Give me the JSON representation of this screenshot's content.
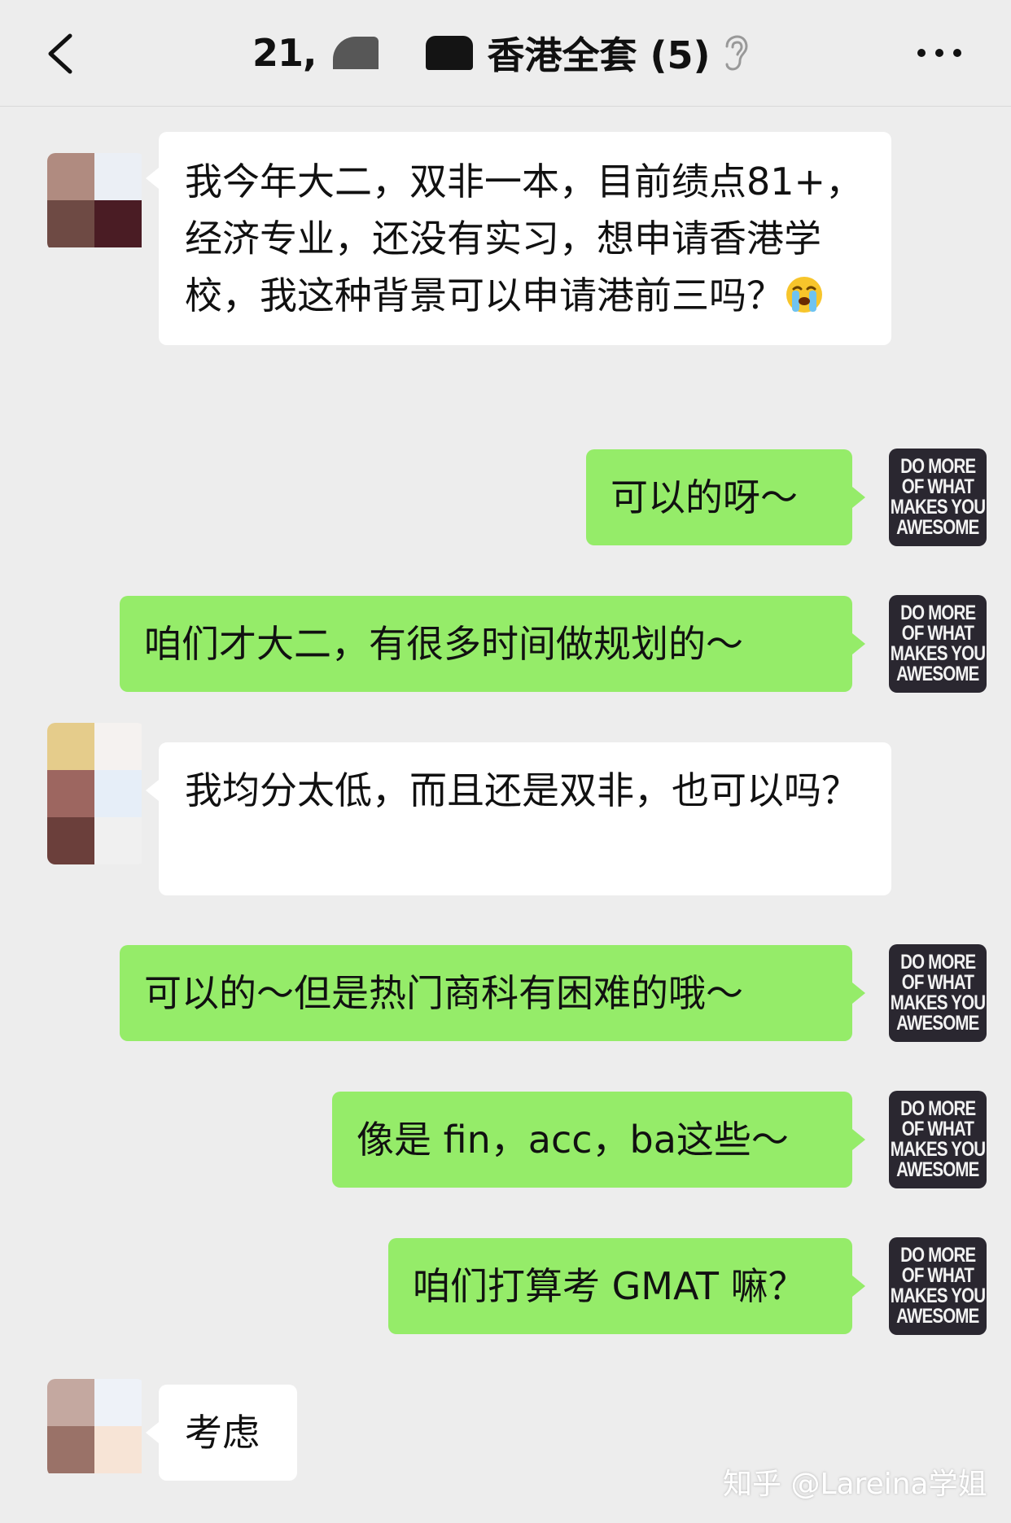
{
  "header": {
    "back_icon": "chevron-left-icon",
    "title_prefix": "21,",
    "title": "香港全套 (5)",
    "mute_icon": "ear-icon",
    "more_icon": "more-dots-icon"
  },
  "messages": [
    {
      "side": "left",
      "text": "我今年大二，双非一本，目前绩点81+，经济专业，还没有实习，想申请香港学校，我这种背景可以申请港前三吗？",
      "emoji": "crying-emoji"
    },
    {
      "side": "right",
      "text": "可以的呀～"
    },
    {
      "side": "right",
      "text": "咱们才大二，有很多时间做规划的～"
    },
    {
      "side": "left",
      "text": "我均分太低，而且还是双非，也可以吗？"
    },
    {
      "side": "right",
      "text": "可以的～但是热门商科有困难的哦～"
    },
    {
      "side": "right",
      "text": "像是 fin，acc，ba这些～"
    },
    {
      "side": "right",
      "text": "咱们打算考 GMAT 嘛？"
    },
    {
      "side": "left",
      "text": "考虑"
    }
  ],
  "self_avatar": {
    "lines": [
      "DO MORE",
      "OF WHAT",
      "MAKES YOU",
      "AWESOME"
    ]
  },
  "watermark": "知乎 @Lareina学姐",
  "colors": {
    "background": "#ededed",
    "bubble_self": "#95ec69",
    "bubble_other": "#ffffff"
  }
}
